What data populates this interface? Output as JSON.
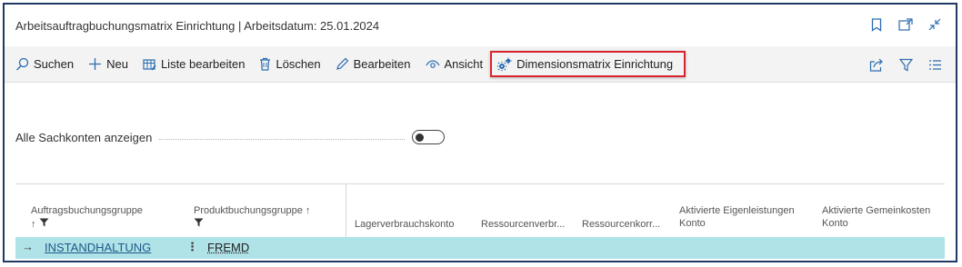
{
  "window": {
    "title": "Arbeitsauftragbuchungsmatrix Einrichtung | Arbeitsdatum: 25.01.2024",
    "icons": [
      "bookmark-icon",
      "open-new-window-icon",
      "collapse-icon"
    ]
  },
  "toolbar": {
    "search": "Suchen",
    "new": "Neu",
    "edit_list": "Liste bearbeiten",
    "delete": "Löschen",
    "edit": "Bearbeiten",
    "view": "Ansicht",
    "dimension_matrix": "Dimensionsmatrix Einrichtung",
    "right_icons": [
      "share-icon",
      "filter-icon",
      "list-view-icon"
    ]
  },
  "filter": {
    "label": "Alle Sachkonten anzeigen",
    "toggle_on": false
  },
  "grid": {
    "columns": [
      {
        "label": "Auftragsbuchungsgruppe",
        "sort": "↑",
        "filter": true
      },
      {
        "label": "Produktbuchungsgruppe ↑",
        "filter": true
      },
      {
        "label": "Lagerverbrauchskonto"
      },
      {
        "label": "Ressourcenverbr..."
      },
      {
        "label": "Ressourcenkorr..."
      },
      {
        "label": "Aktivierte Eigenleistungen",
        "label2": "Konto"
      },
      {
        "label": "Aktivierte Gemeinkosten",
        "label2": "Konto"
      }
    ],
    "rows": [
      {
        "arrow": "→",
        "group": "INSTANDHALTUNG",
        "menu": "⋮",
        "product": "FREMD"
      }
    ]
  },
  "colors": {
    "accent": "#2b6cb0",
    "highlight_border": "#d9232d",
    "frame_border": "#1f3864",
    "selected_row": "#b0e3e8"
  }
}
